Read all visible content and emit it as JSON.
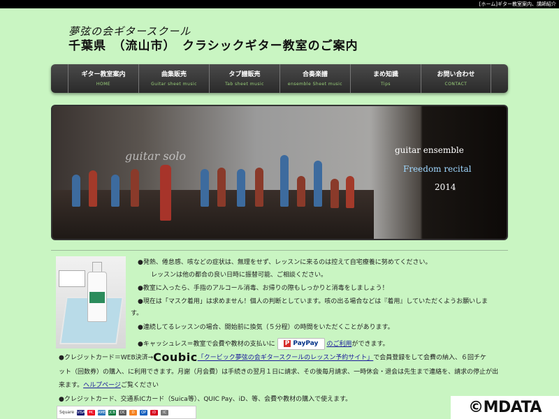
{
  "topbar": {
    "text": "[ホーム]ギター教室案内、講師紹介"
  },
  "header": {
    "subtitle": "夢弦の会ギタースクール",
    "title": "千葉県　（流山市）　クラシックギター教室のご案内"
  },
  "nav": {
    "items": [
      {
        "label": "ギター教室案内",
        "en": "HOME"
      },
      {
        "label": "曲集販売",
        "en": "Guitar sheet music"
      },
      {
        "label": "タブ譜販売",
        "en": "Tab sheet music"
      },
      {
        "label": "合奏楽譜",
        "en": "ensemble Sheet music"
      },
      {
        "label": "まめ知識",
        "en": "Tips"
      },
      {
        "label": "お問い合わせ",
        "en": "CONTACT"
      }
    ]
  },
  "hero": {
    "solo_text": "guitar solo",
    "ensemble_line1": "guitar ensemble",
    "ensemble_line2": "Freedom recital",
    "ensemble_line3": "2014"
  },
  "notices": {
    "n1": "●発熱、倦怠感、咳などの症状は、無理をせず、レッスンに来るのは控えて自宅療養に努めてください。",
    "n2": "レッスンは他の都合の良い日時に振替可能、ご相談ください。",
    "n3": "●教室に入ったら、手指のアルコール消毒、お帰りの際もしっかりと消毒をしましょう！",
    "n4a": "●現在は「マスク着用」は求めません！個人の判断としています。咳の出る場合などは『着用』していただくようお願いしま",
    "n4b": "す。",
    "n5": "●連続してるレッスンの場合、開始前に換気（５分程）の時間をいただくことがあります。",
    "n6_pre": "●キャッシュレス＝教室で会費や教材の支払いに",
    "n6_link": "のご利用",
    "n6_post": "ができます。",
    "paypal_label": "PayPay",
    "paypal_mark": "P",
    "n7_pre": "●クレジットカード＝WEB決済→",
    "coubic": "Coubic",
    "n7_link": "「クービック夢弦の会ギタースクールのレッスン予約サイト」",
    "n7_post": "で会員登録をして会費の納入、６回チケ",
    "n8": "ット（回数券）の購入、に利用できます。月謝（月会費）は手続きの翌月１日に請求、その後毎月請求、一時休会・退会は先生まで連絡を、請求の停止が出",
    "n9_pre": "来ます。",
    "n9_link": "ヘルプページ",
    "n9_post": "ご覧ください",
    "n10": "●クレジットカード、交通系ICカード（Suica等）、QUIC Pay、iD、等、会費や教材の購入で使えます。"
  },
  "cards_bar": {
    "label": "Square",
    "items": [
      {
        "name": "VISA",
        "color": "#1a1f71"
      },
      {
        "name": "MC",
        "color": "#eb001b"
      },
      {
        "name": "AMEX",
        "color": "#2e77bb"
      },
      {
        "name": "JCB",
        "color": "#0b7a3e"
      },
      {
        "name": "DC",
        "color": "#5a5a5a"
      },
      {
        "name": "D",
        "color": "#f58220"
      },
      {
        "name": "QP",
        "color": "#1560bd"
      },
      {
        "name": "iD",
        "color": "#d6001c"
      },
      {
        "name": "IC",
        "color": "#777777"
      }
    ]
  },
  "watermark": "©MDATA"
}
